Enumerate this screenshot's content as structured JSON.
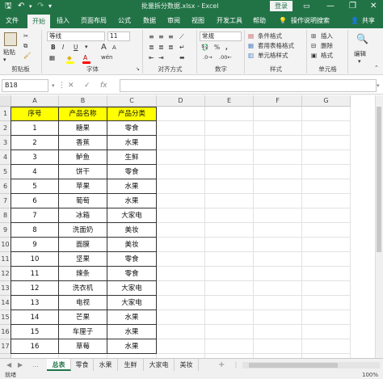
{
  "titlebar": {
    "save_icon": "save-icon",
    "undo_icon": "undo-icon",
    "redo_icon": "redo-icon",
    "title": "批量拆分数据.xlsx - Excel",
    "login": "登录",
    "minimize": "—",
    "restore": "❐",
    "close": "✕"
  },
  "tabs": [
    "文件",
    "开始",
    "插入",
    "页面布局",
    "公式",
    "数据",
    "审阅",
    "视图",
    "开发工具",
    "帮助"
  ],
  "tell_me": "操作说明搜索",
  "share": "共享",
  "ribbon": {
    "clipboard": {
      "paste": "粘贴",
      "label": "剪贴板"
    },
    "font": {
      "name": "等线",
      "size": "11",
      "label": "字体",
      "bold": "B",
      "italic": "I",
      "underline": "U",
      "grow": "A",
      "shrink": "A",
      "color_char": "A",
      "wen": "wén"
    },
    "alignment": {
      "label": "对齐方式"
    },
    "number": {
      "format": "常规",
      "percent": "%",
      "comma": ",",
      "label": "数字"
    },
    "styles": {
      "conditional": "条件格式",
      "table": "套用表格格式",
      "cell_styles": "单元格样式",
      "label": "样式"
    },
    "cells": {
      "insert": "插入",
      "delete": "删除",
      "format": "格式",
      "label": "单元格"
    },
    "editing": {
      "label": "编辑"
    }
  },
  "formula_bar": {
    "name_box": "B18",
    "cancel": "✕",
    "enter": "✓",
    "fx": "fx",
    "value": ""
  },
  "columns": [
    "A",
    "B",
    "C",
    "D",
    "E",
    "F",
    "G"
  ],
  "table": {
    "headers": [
      "序号",
      "产品名称",
      "产品分类"
    ],
    "rows": [
      [
        "1",
        "糖果",
        "零食"
      ],
      [
        "2",
        "香蕉",
        "水果"
      ],
      [
        "3",
        "鲈鱼",
        "生鲜"
      ],
      [
        "4",
        "饼干",
        "零食"
      ],
      [
        "5",
        "苹果",
        "水果"
      ],
      [
        "6",
        "葡萄",
        "水果"
      ],
      [
        "7",
        "冰箱",
        "大家电"
      ],
      [
        "8",
        "洗面奶",
        "美妆"
      ],
      [
        "9",
        "面膜",
        "美妆"
      ],
      [
        "10",
        "坚果",
        "零食"
      ],
      [
        "11",
        "辣条",
        "零食"
      ],
      [
        "12",
        "洗衣机",
        "大家电"
      ],
      [
        "13",
        "电视",
        "大家电"
      ],
      [
        "14",
        "芒果",
        "水果"
      ],
      [
        "15",
        "车厘子",
        "水果"
      ],
      [
        "16",
        "草莓",
        "水果"
      ]
    ]
  },
  "row_numbers": [
    "1",
    "2",
    "3",
    "4",
    "5",
    "6",
    "7",
    "8",
    "9",
    "10",
    "11",
    "12",
    "13",
    "14",
    "15",
    "16",
    "17",
    "18"
  ],
  "sheets": [
    "总表",
    "零食",
    "水果",
    "生鲜",
    "大家电",
    "美妆"
  ],
  "active_sheet": "总表",
  "add_sheet": "+",
  "status": {
    "ready": "就绪",
    "zoom": "100%"
  },
  "colors": {
    "excel_green": "#217346",
    "header_fill": "#ffff00"
  }
}
